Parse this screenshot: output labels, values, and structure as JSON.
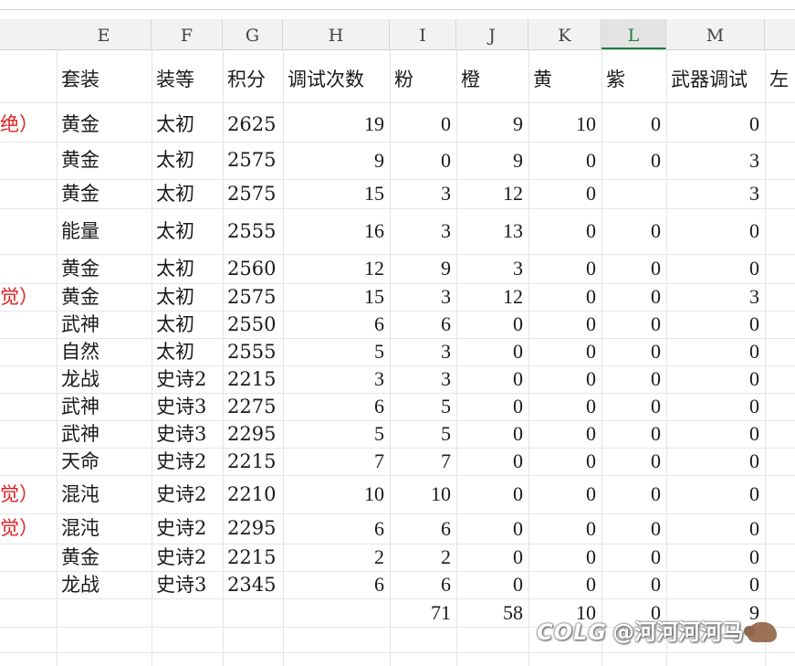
{
  "columns": [
    {
      "letter": "E"
    },
    {
      "letter": "F"
    },
    {
      "letter": "G"
    },
    {
      "letter": "H"
    },
    {
      "letter": "I"
    },
    {
      "letter": "J"
    },
    {
      "letter": "K"
    },
    {
      "letter": "L"
    },
    {
      "letter": "M"
    }
  ],
  "header_row": {
    "E": "套装",
    "F": "装等",
    "G": "积分",
    "H": "调试次数",
    "I": "粉",
    "J": "橙",
    "K": "黄",
    "L": "紫",
    "M": "武器调试",
    "N": "左"
  },
  "rows": [
    {
      "side": "绝）",
      "E": "黄金",
      "F": "太初",
      "G": "2625",
      "H": "19",
      "I": "0",
      "J": "9",
      "K": "10",
      "L": "0",
      "M": "0"
    },
    {
      "side": "",
      "E": "黄金",
      "F": "太初",
      "G": "2575",
      "H": "9",
      "I": "0",
      "J": "9",
      "K": "0",
      "L": "0",
      "M": "3"
    },
    {
      "side": "",
      "E": "黄金",
      "F": "太初",
      "G": "2575",
      "H": "15",
      "I": "3",
      "J": "12",
      "K": "0",
      "L": "",
      "M": "3"
    },
    {
      "side": "",
      "E": "能量",
      "F": "太初",
      "G": "2555",
      "H": "16",
      "I": "3",
      "J": "13",
      "K": "0",
      "L": "0",
      "M": "0"
    },
    {
      "side": "",
      "E": "黄金",
      "F": "太初",
      "G": "2560",
      "H": "12",
      "I": "9",
      "J": "3",
      "K": "0",
      "L": "0",
      "M": "0"
    },
    {
      "side": "觉）",
      "E": "黄金",
      "F": "太初",
      "G": "2575",
      "H": "15",
      "I": "3",
      "J": "12",
      "K": "0",
      "L": "0",
      "M": "3"
    },
    {
      "side": "",
      "E": "武神",
      "F": "太初",
      "G": "2550",
      "H": "6",
      "I": "6",
      "J": "0",
      "K": "0",
      "L": "0",
      "M": "0"
    },
    {
      "side": "",
      "E": "自然",
      "F": "太初",
      "G": "2555",
      "H": "5",
      "I": "3",
      "J": "0",
      "K": "0",
      "L": "0",
      "M": "0"
    },
    {
      "side": "",
      "E": "龙战",
      "F": "史诗2",
      "G": "2215",
      "H": "3",
      "I": "3",
      "J": "0",
      "K": "0",
      "L": "0",
      "M": "0"
    },
    {
      "side": "",
      "E": "武神",
      "F": "史诗3",
      "G": "2275",
      "H": "6",
      "I": "5",
      "J": "0",
      "K": "0",
      "L": "0",
      "M": "0"
    },
    {
      "side": "",
      "E": "武神",
      "F": "史诗3",
      "G": "2295",
      "H": "5",
      "I": "5",
      "J": "0",
      "K": "0",
      "L": "0",
      "M": "0"
    },
    {
      "side": "",
      "E": "天命",
      "F": "史诗2",
      "G": "2215",
      "H": "7",
      "I": "7",
      "J": "0",
      "K": "0",
      "L": "0",
      "M": "0"
    },
    {
      "side": "觉）",
      "E": "混沌",
      "F": "史诗2",
      "G": "2210",
      "H": "10",
      "I": "10",
      "J": "0",
      "K": "0",
      "L": "0",
      "M": "0"
    },
    {
      "side": "觉）",
      "E": "混沌",
      "F": "史诗2",
      "G": "2295",
      "H": "6",
      "I": "6",
      "J": "0",
      "K": "0",
      "L": "0",
      "M": "0"
    },
    {
      "side": "",
      "E": "黄金",
      "F": "史诗2",
      "G": "2215",
      "H": "2",
      "I": "2",
      "J": "0",
      "K": "0",
      "L": "0",
      "M": "0"
    },
    {
      "side": "",
      "E": "龙战",
      "F": "史诗3",
      "G": "2345",
      "H": "6",
      "I": "6",
      "J": "0",
      "K": "0",
      "L": "0",
      "M": "0"
    }
  ],
  "totals": {
    "I": "71",
    "J": "58",
    "K": "10",
    "L": "0",
    "M": "9"
  },
  "watermark": {
    "logo": "COLG",
    "handle": "@河河河河马"
  },
  "colors": {
    "side_note": "#e02020",
    "selected_column": "#1e7e45",
    "header_bg": "#f2f2f2",
    "grid": "#e3e3e3"
  }
}
